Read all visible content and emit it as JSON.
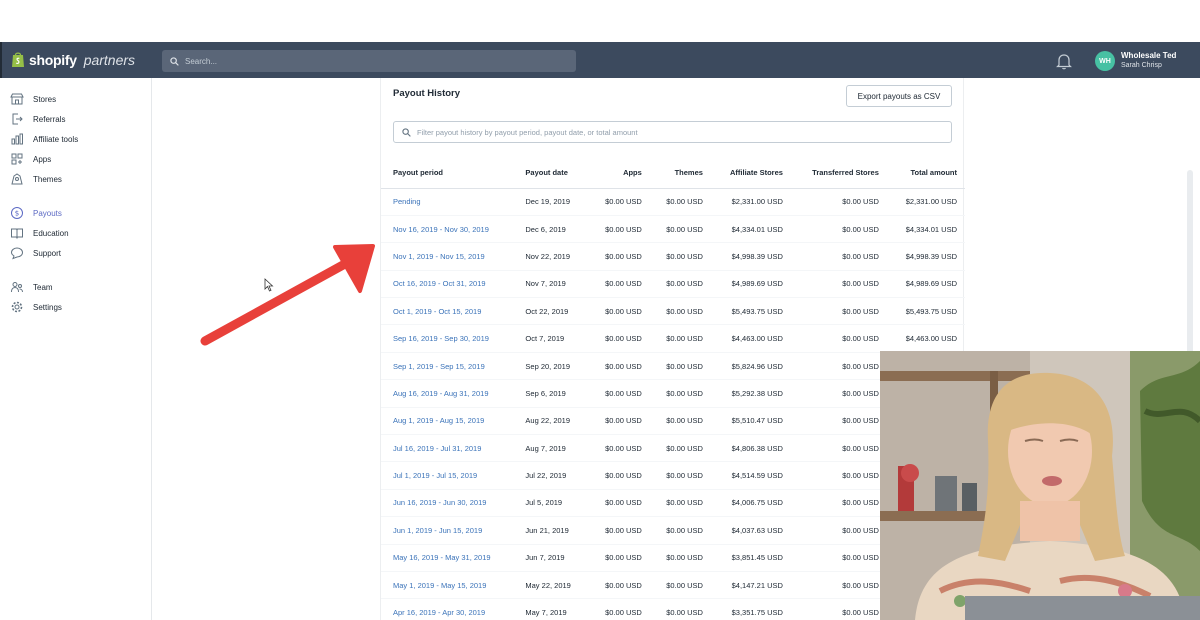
{
  "topbar": {
    "brand": "shopify",
    "brand_sub": "partners",
    "search_placeholder": "Search...",
    "account_initials": "WH",
    "account_name": "Wholesale Ted",
    "account_user": "Sarah Chrisp"
  },
  "sidebar": {
    "items": [
      {
        "label": "Stores",
        "icon": "store-icon"
      },
      {
        "label": "Referrals",
        "icon": "referrals-icon"
      },
      {
        "label": "Affiliate tools",
        "icon": "chart-icon"
      },
      {
        "label": "Apps",
        "icon": "apps-icon"
      },
      {
        "label": "Themes",
        "icon": "themes-icon"
      },
      {
        "label": "Payouts",
        "icon": "dollar-icon",
        "active": true
      },
      {
        "label": "Education",
        "icon": "book-icon"
      },
      {
        "label": "Support",
        "icon": "chat-icon"
      },
      {
        "label": "Team",
        "icon": "team-icon"
      },
      {
        "label": "Settings",
        "icon": "gear-icon"
      }
    ]
  },
  "payouts": {
    "title": "Payout History",
    "export_label": "Export payouts as CSV",
    "filter_placeholder": "Filter payout history by payout period, payout date, or total amount",
    "columns": [
      "Payout period",
      "Payout date",
      "Apps",
      "Themes",
      "Affiliate Stores",
      "Transferred Stores",
      "Total amount"
    ],
    "rows": [
      [
        "Pending",
        "Dec 19, 2019",
        "$0.00 USD",
        "$0.00 USD",
        "$2,331.00 USD",
        "$0.00 USD",
        "$2,331.00 USD"
      ],
      [
        "Nov 16, 2019 - Nov 30, 2019",
        "Dec 6, 2019",
        "$0.00 USD",
        "$0.00 USD",
        "$4,334.01 USD",
        "$0.00 USD",
        "$4,334.01 USD"
      ],
      [
        "Nov 1, 2019 - Nov 15, 2019",
        "Nov 22, 2019",
        "$0.00 USD",
        "$0.00 USD",
        "$4,998.39 USD",
        "$0.00 USD",
        "$4,998.39 USD"
      ],
      [
        "Oct 16, 2019 - Oct 31, 2019",
        "Nov 7, 2019",
        "$0.00 USD",
        "$0.00 USD",
        "$4,989.69 USD",
        "$0.00 USD",
        "$4,989.69 USD"
      ],
      [
        "Oct 1, 2019 - Oct 15, 2019",
        "Oct 22, 2019",
        "$0.00 USD",
        "$0.00 USD",
        "$5,493.75 USD",
        "$0.00 USD",
        "$5,493.75 USD"
      ],
      [
        "Sep 16, 2019 - Sep 30, 2019",
        "Oct 7, 2019",
        "$0.00 USD",
        "$0.00 USD",
        "$4,463.00 USD",
        "$0.00 USD",
        "$4,463.00 USD"
      ],
      [
        "Sep 1, 2019 - Sep 15, 2019",
        "Sep 20, 2019",
        "$0.00 USD",
        "$0.00 USD",
        "$5,824.96 USD",
        "$0.00 USD",
        ""
      ],
      [
        "Aug 16, 2019 - Aug 31, 2019",
        "Sep 6, 2019",
        "$0.00 USD",
        "$0.00 USD",
        "$5,292.38 USD",
        "$0.00 USD",
        ""
      ],
      [
        "Aug 1, 2019 - Aug 15, 2019",
        "Aug 22, 2019",
        "$0.00 USD",
        "$0.00 USD",
        "$5,510.47 USD",
        "$0.00 USD",
        ""
      ],
      [
        "Jul 16, 2019 - Jul 31, 2019",
        "Aug 7, 2019",
        "$0.00 USD",
        "$0.00 USD",
        "$4,806.38 USD",
        "$0.00 USD",
        ""
      ],
      [
        "Jul 1, 2019 - Jul 15, 2019",
        "Jul 22, 2019",
        "$0.00 USD",
        "$0.00 USD",
        "$4,514.59 USD",
        "$0.00 USD",
        ""
      ],
      [
        "Jun 16, 2019 - Jun 30, 2019",
        "Jul 5, 2019",
        "$0.00 USD",
        "$0.00 USD",
        "$4,006.75 USD",
        "$0.00 USD",
        ""
      ],
      [
        "Jun 1, 2019 - Jun 15, 2019",
        "Jun 21, 2019",
        "$0.00 USD",
        "$0.00 USD",
        "$4,037.63 USD",
        "$0.00 USD",
        ""
      ],
      [
        "May 16, 2019 - May 31, 2019",
        "Jun 7, 2019",
        "$0.00 USD",
        "$0.00 USD",
        "$3,851.45 USD",
        "$0.00 USD",
        ""
      ],
      [
        "May 1, 2019 - May 15, 2019",
        "May 22, 2019",
        "$0.00 USD",
        "$0.00 USD",
        "$4,147.21 USD",
        "$0.00 USD",
        ""
      ],
      [
        "Apr 16, 2019 - Apr 30, 2019",
        "May 7, 2019",
        "$0.00 USD",
        "$0.00 USD",
        "$3,351.75 USD",
        "$0.00 USD",
        ""
      ]
    ]
  },
  "colors": {
    "topbar": "#3c4a5e",
    "link": "#3b73b9",
    "active_nav": "#5c6ac4",
    "arrow": "#e8403a",
    "avatar": "#47c1a3"
  }
}
